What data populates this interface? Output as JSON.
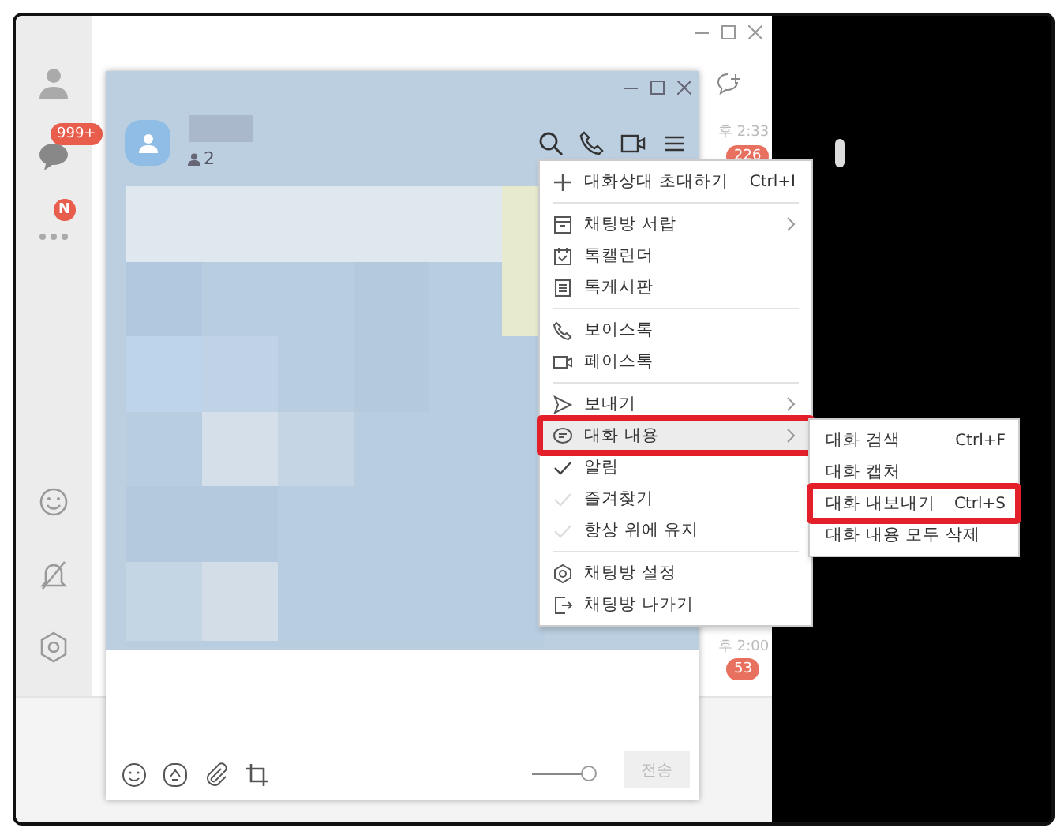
{
  "sidebar": {
    "items": [
      {
        "kind": "profile"
      },
      {
        "kind": "chats",
        "badge": "999+"
      },
      {
        "kind": "more",
        "badge": "N"
      }
    ],
    "bottom_items": [
      {
        "kind": "emoji"
      },
      {
        "kind": "mute"
      },
      {
        "kind": "settings"
      }
    ]
  },
  "chat_list": {
    "times": [
      "후 2:33",
      "후 2:00"
    ],
    "badges": [
      "226",
      "53"
    ]
  },
  "chat_window": {
    "member_count": "2",
    "input": {
      "send_button": {
        "label": "전송",
        "disabled": true
      },
      "slider": {
        "level": 1
      }
    }
  },
  "menu": {
    "sections": [
      [
        {
          "label": "대화상대 초대하기",
          "shortcut": "Ctrl+I",
          "kind": "command"
        }
      ],
      [
        {
          "label": "채팅방 서랍",
          "kind": "command",
          "submenu": true
        },
        {
          "label": "톡캘린더",
          "kind": "command"
        },
        {
          "label": "톡게시판",
          "kind": "command"
        }
      ],
      [
        {
          "label": "보이스톡",
          "kind": "command"
        },
        {
          "label": "페이스톡",
          "kind": "command"
        }
      ],
      [
        {
          "label": "보내기",
          "kind": "command",
          "submenu": true
        },
        {
          "label": "대화 내용",
          "kind": "command",
          "submenu": true,
          "selected": true,
          "annotated": true
        },
        {
          "label": "알림",
          "kind": "check",
          "checked": true
        },
        {
          "label": "즐겨찾기",
          "kind": "check",
          "checked": false
        },
        {
          "label": "항상 위에 유지",
          "kind": "check",
          "checked": false
        }
      ],
      [
        {
          "label": "채팅방 설정",
          "kind": "command"
        },
        {
          "label": "채팅방 나가기",
          "kind": "command"
        }
      ]
    ]
  },
  "submenu": {
    "items": [
      {
        "label": "대화 검색",
        "shortcut": "Ctrl+F",
        "annotated": false
      },
      {
        "label": "대화 캡처",
        "annotated": false
      },
      {
        "label": "대화 내보내기",
        "shortcut": "Ctrl+S",
        "annotated": true
      },
      {
        "label": "대화 내용 모두 삭제",
        "annotated": false
      }
    ]
  }
}
